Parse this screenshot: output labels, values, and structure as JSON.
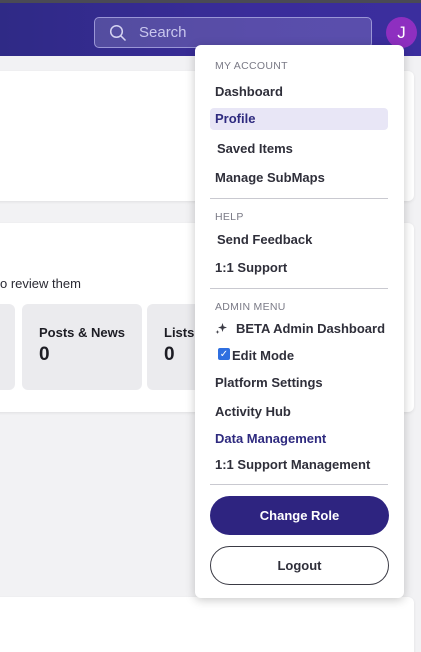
{
  "header": {
    "search": {
      "placeholder": "Search"
    },
    "avatar_initial": "J"
  },
  "background": {
    "review_text": "o review them",
    "stats": [
      {
        "label": "Posts & News",
        "value": "0"
      },
      {
        "label": "Lists",
        "value": "0"
      }
    ]
  },
  "menu": {
    "sections": {
      "my_account": "MY ACCOUNT",
      "help": "HELP",
      "admin_menu": "ADMIN MENU"
    },
    "items": {
      "dashboard": "Dashboard",
      "profile": "Profile",
      "saved_items": "Saved Items",
      "manage_submaps": "Manage SubMaps",
      "send_feedback": "Send Feedback",
      "support": "1:1 Support",
      "beta_admin_dashboard": "BETA Admin Dashboard",
      "edit_mode": "Edit Mode",
      "platform_settings": "Platform Settings",
      "activity_hub": "Activity Hub",
      "data_management": "Data Management",
      "support_management": "1:1 Support Management"
    },
    "edit_mode_checked": true,
    "buttons": {
      "change_role": "Change Role",
      "logout": "Logout"
    }
  },
  "colors": {
    "nav_bg": "#35289a",
    "accent": "#2e2480",
    "avatar_bg": "#8e2fc0"
  }
}
